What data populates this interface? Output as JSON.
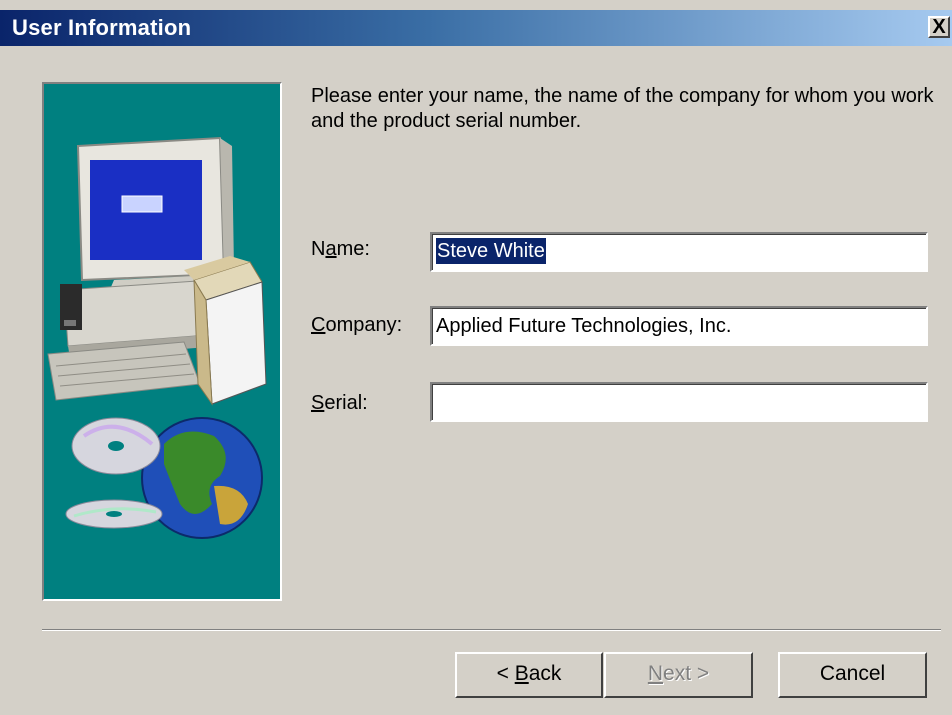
{
  "window": {
    "title": "User Information",
    "close_symbol": "X"
  },
  "intro_text": "Please enter your name, the name of the company for whom you work and the product serial number.",
  "fields": {
    "name": {
      "label_pre": "N",
      "label_ul": "a",
      "label_post": "me:",
      "value": "Steve White"
    },
    "company": {
      "label_pre": "",
      "label_ul": "C",
      "label_post": "ompany:",
      "value": "Applied Future Technologies, Inc."
    },
    "serial": {
      "label_pre": "",
      "label_ul": "S",
      "label_post": "erial:",
      "value": ""
    }
  },
  "buttons": {
    "back": {
      "pre": "< ",
      "ul": "B",
      "post": "ack"
    },
    "next": {
      "pre": "",
      "ul": "N",
      "post": "ext >"
    },
    "cancel": {
      "label": "Cancel"
    }
  },
  "side_image": {
    "icon": "computer-cd-globe-illustration",
    "background_color": "#008080"
  },
  "colors": {
    "titlebar_start": "#0a246a",
    "titlebar_end": "#a6caf0",
    "dialog_bg": "#d4d0c8",
    "selection": "#0a246a"
  }
}
